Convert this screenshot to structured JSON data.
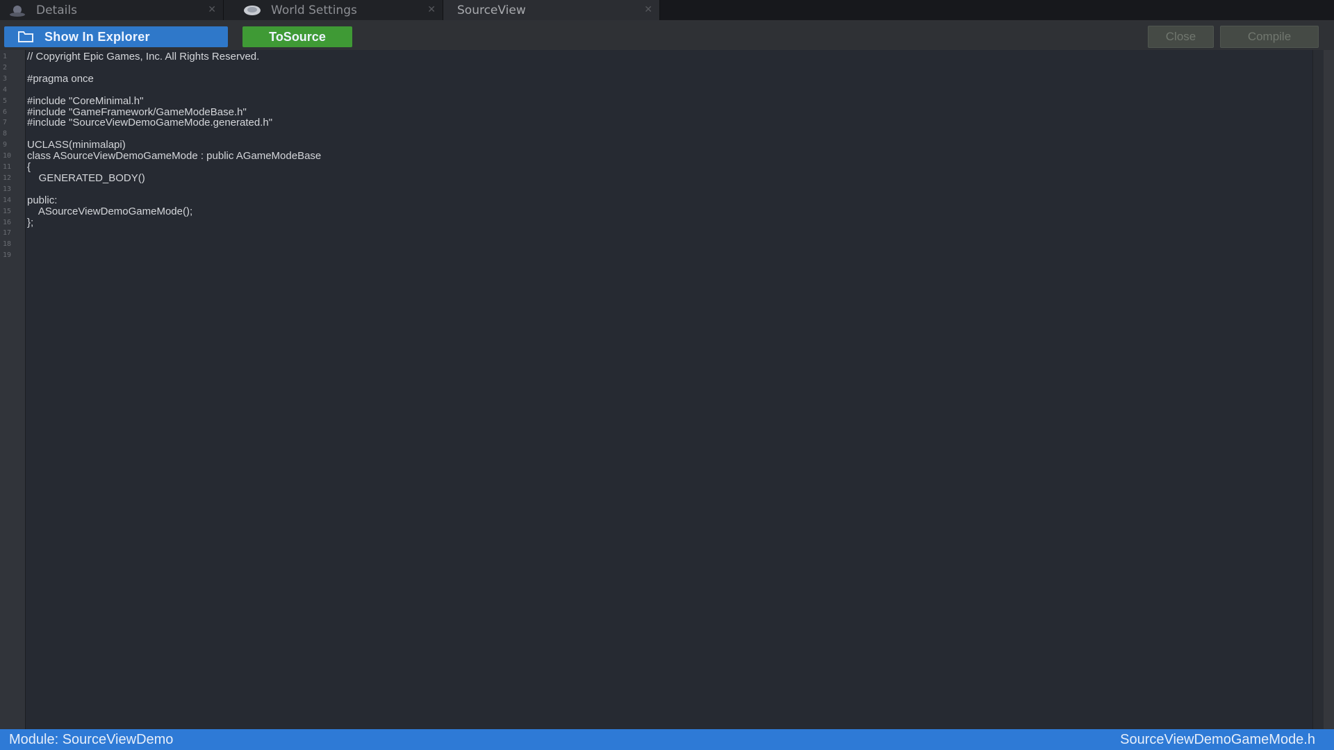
{
  "tabs": [
    {
      "label": "Details",
      "icon": "details-icon",
      "active": false
    },
    {
      "label": "World Settings",
      "icon": "world-icon",
      "active": false
    },
    {
      "label": "SourceView",
      "icon": "",
      "active": true
    }
  ],
  "toolbar": {
    "show_in_explorer_label": "Show In Explorer",
    "to_source_label": "ToSource",
    "close_label": "Close",
    "compile_label": "Compile"
  },
  "editor": {
    "line_numbers": [
      "1",
      "2",
      "3",
      "4",
      "5",
      "6",
      "7",
      "8",
      "9",
      "10",
      "11",
      "12",
      "13",
      "14",
      "15",
      "16",
      "17",
      "18",
      "19"
    ],
    "code_lines": [
      "// Copyright Epic Games, Inc. All Rights Reserved.",
      "",
      "#pragma once",
      "",
      "#include \"CoreMinimal.h\"",
      "#include \"GameFramework/GameModeBase.h\"",
      "#include \"SourceViewDemoGameMode.generated.h\"",
      "",
      "UCLASS(minimalapi)",
      "class ASourceViewDemoGameMode : public AGameModeBase",
      "{",
      "    GENERATED_BODY()",
      "",
      "public:",
      "    ASourceViewDemoGameMode();",
      "};",
      "",
      "",
      ""
    ]
  },
  "statusbar": {
    "module_text": "Module: SourceViewDemo",
    "file_text": "SourceViewDemoGameMode.h"
  },
  "colors": {
    "explorer_button": "#2f78c9",
    "to_source_button": "#3f9a35",
    "status_bar": "#2e7ad6",
    "editor_background": "#262a32"
  }
}
